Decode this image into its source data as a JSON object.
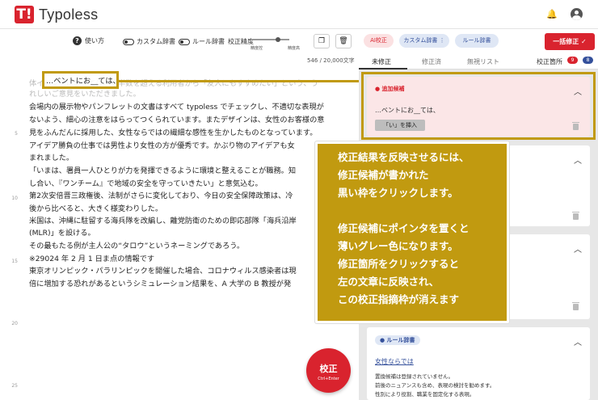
{
  "app": {
    "logo_mark": "T!",
    "name": "Typoless"
  },
  "toolbar": {
    "help_label": "使い方",
    "custom_dict_label": "カスタム辞書",
    "rule_dict_label": "ルール辞書",
    "strictness_label": "校正精度",
    "slider_left": "精度控",
    "slider_right": "精度高",
    "ai_filter": "AI校正",
    "custom_filter": "カスタム辞書 ⋮",
    "rule_filter": "ルール辞書",
    "bulk_fix_label": "一括修正 ✓"
  },
  "status": {
    "char_count": "546 / 20,000文字",
    "tabs": [
      "未修正",
      "修正済",
      "無視リスト"
    ],
    "correction_count_label": "校正箇所",
    "badge_red": "9",
    "badge_blue": "8"
  },
  "editor": {
    "line_numbers": [
      "5",
      "10",
      "15",
      "20",
      "25"
    ],
    "lines": [
      "体イベントにお__ては、過半数を超える利用者から「友人にもすすめたい」という、う",
      "れしいご意見をいただきました。",
      "会場内の展示物やパンフレットの文書はすべて typoless でチェックし、不適切な表現が",
      "ないよう、細心の注意をはらってつくられています。またデザインは、女性のお客様の意",
      "見をふんだんに採用した、女性ならではの繊細な感性を生かしたものとなっています。",
      "アイデア勝負の仕事では男性より女性の方が優秀です。かぶり物のアイデアも女",
      "まれました。",
      "「いまは、署員一人ひとりが力を発揮できるように環境と整えることが職務。知",
      "し合い、『ワンチーム』で地域の安全を守っていきたい」と意気込む。",
      "第2次安倍晋三政権後、法制がさらに変化しており、今日の安全保障政策は、冷",
      "後から比べると、大きく様変わりした。",
      "米国は、沖縄に駐留する海兵隊を改編し、離党防衛のための即応部隊「海兵沿岸",
      "(MLR)」を設ける。",
      "その最もたる例が主人公の“タロウ”というネーミングであろう。",
      "※29024 年 2 月 1 日ま点の情報です",
      "東京オリンピック・パラリンピックを開催した場合、コロナウィルス感染者は現",
      "倍に増加する恐れがあるというシミュレーション結果を、A 大学の B 教授が発"
    ]
  },
  "cards": {
    "card1": {
      "tag": "● 追加候補",
      "snippet": "…ベントにお__ては、",
      "suggestion": "「い」を挿入"
    },
    "card4": {
      "tag": "● ルール辞書",
      "term": "女性ならでは",
      "msg1": "置換候補は登録されていません。",
      "msg2": "前後のニュアンスも含め、表現の検討を勧めます。",
      "msg3": "性別により役割、職業を固定化する表現。"
    }
  },
  "callout": {
    "lines": [
      "校正結果を反映させるには、",
      "修正候補が書かれた",
      "黒い枠をクリックします。",
      "",
      "修正候補にポインタを置くと",
      "薄いグレー色になります。",
      "修正箇所をクリックすると",
      "左の文章に反映され、",
      "この校正指摘枠が消えます"
    ]
  },
  "run_button": {
    "label": "校正",
    "shortcut": "Ctrl+Enter"
  },
  "colors": {
    "brand_red": "#d9232e",
    "gold": "#c19a10",
    "blue": "#34509b"
  }
}
